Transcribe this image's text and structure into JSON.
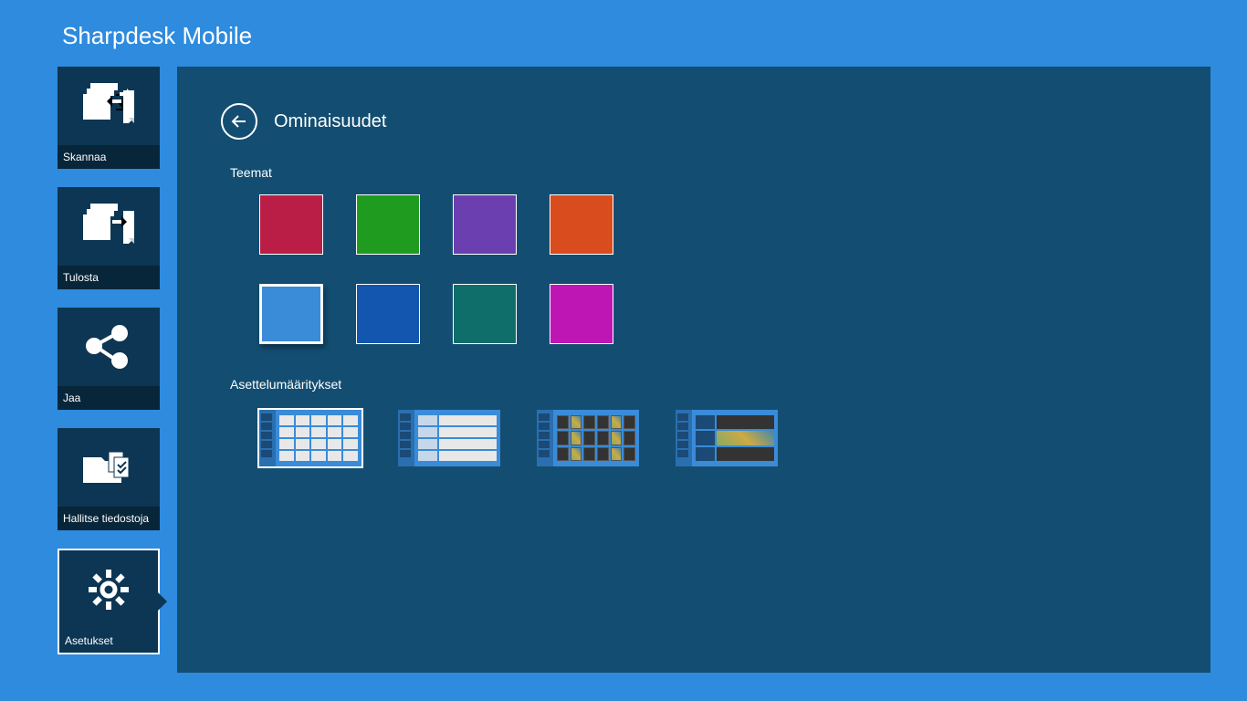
{
  "app": {
    "title": "Sharpdesk Mobile"
  },
  "sidebar": {
    "items": [
      {
        "label": "Skannaa"
      },
      {
        "label": "Tulosta"
      },
      {
        "label": "Jaa"
      },
      {
        "label": "Hallitse tiedostoja"
      },
      {
        "label": "Asetukset"
      }
    ],
    "activeIndex": 4
  },
  "page": {
    "title": "Ominaisuudet"
  },
  "sections": {
    "themes": {
      "label": "Teemat",
      "colors": [
        "#ba1e46",
        "#1f9c1f",
        "#6b3fb0",
        "#d84c1e",
        "#3a8bd8",
        "#1256b0",
        "#0f6e6a",
        "#bd16b5"
      ],
      "activeIndex": 4
    },
    "layouts": {
      "label": "Asettelumääritykset",
      "count": 4,
      "activeIndex": 0
    }
  }
}
